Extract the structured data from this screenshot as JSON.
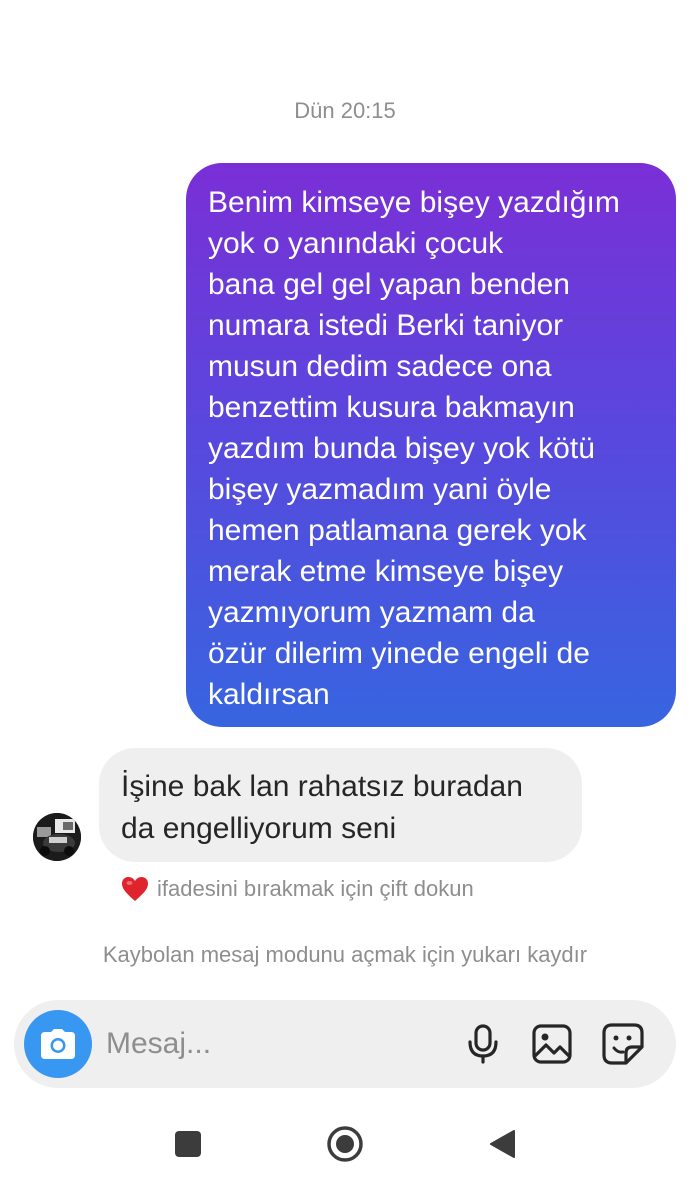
{
  "thread": {
    "timestamp": "Dün 20:15",
    "sent_message": {
      "lines": [
        "Benim kimseye bişey yazdığım",
        "yok o yanındaki çocuk",
        "bana gel gel yapan benden",
        "numara istedi Berki taniyor",
        "musun dedim sadece ona",
        "benzettim kusura bakmayın",
        "yazdım bunda bişey yok kötü",
        "bişey yazmadım yani öyle",
        "hemen patlamana gerek yok",
        "merak etme kimseye bişey",
        "yazmıyorum yazmam da",
        "özür dilerim yinede engeli de",
        "kaldırsan"
      ],
      "gradient_top": "#7a2fd6",
      "gradient_bottom": "#3765e0"
    },
    "received_message": {
      "lines": [
        "İşine bak lan rahatsız buradan",
        "da engelliyorum seni"
      ]
    },
    "reaction_hint": {
      "emoji": "❤️",
      "text": "ifadesini bırakmak için çift dokun"
    },
    "vanish_hint": "Kaybolan mesaj modunu açmak için yukarı kaydır"
  },
  "composer": {
    "placeholder": "Mesaj...",
    "camera_icon": "camera-icon",
    "icons": [
      "microphone-icon",
      "gallery-icon",
      "sticker-icon"
    ],
    "accent": "#3897f0"
  },
  "nav": {
    "icons": [
      "recent-apps-icon",
      "home-icon",
      "back-icon"
    ]
  }
}
